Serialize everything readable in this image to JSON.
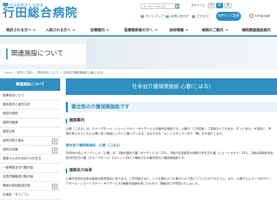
{
  "header": {
    "logo_sub": "社会医療法人 壮幸会",
    "logo_main": "行田総合病院",
    "search_placeholder": "キーワードを入力",
    "links": [
      "サイトマップ",
      "お問い合わせ",
      "アクセス"
    ],
    "text_size_label": "文字サイズ",
    "size_buttons": [
      "小",
      "中",
      "大"
    ],
    "font_button": "文字サイズ変更",
    "language": "Language"
  },
  "nav": {
    "items": [
      "受診される方へ",
      "入院される方へ",
      "診療案内",
      "医療関係者の方へ",
      "採用情報",
      "病院のご案内",
      "病院関連施設案内"
    ]
  },
  "banner": {
    "title": "関連施設について"
  },
  "breadcrumb": {
    "items": [
      "Home",
      "病院のご案内",
      "関連施設について"
    ],
    "current": "壮幸会介護保険施設 心春(こはる)"
  },
  "sidebar": {
    "heading": "関連施設について",
    "items": [
      "理事長あいさつ",
      "基本理念と運営方針",
      "病院の特色",
      "病院の概要",
      "病院沿革",
      "病院の取り組み",
      "病院の実績",
      "患者さんのための7つの宣言",
      "一般事業主の行動計画",
      "女性活躍推進行動計画",
      "職員の負担軽減対策",
      "広報誌「そうこう」"
    ]
  },
  "main": {
    "title": "壮幸会介護保険施設 心春(こはる)",
    "h2": "複合型の介護保険施設です",
    "section1_title": "施設案内",
    "section1_text": "心春（こはる）は、グループホーム・ショートステイ・デイサービスの複合型施設です。心春は「ご利用者・ご家族がいつも安心・ずっと安心」を理念に、地域の皆さまとともに心通い合う施設にしたいと願っています。みなさまの「心」にスタッフ一同で「春」をお届けします。",
    "sub_title": "複合型介護保険施設　心春（こはる）",
    "sub_text": "2009年4月にオープンした「心春」は、3階の通所介護（デイサービス）25人、2階が全室個室の短期入所生活介護（ショートステイ）20人、3階は認知症対応型共同生活介護（グループホーム）2ユニット18人で構成される複合型の介護保険施設です。",
    "section2_title": "施設名の由来",
    "section2_text": "心春の名前の由来は施設の基本理念にあります。ご利用者さまに、いつも春のように暖かい心で過ごしていただけるように。また、心春ちゃんマークはグループホーム・ショートステイ・デイサービス3事業の協調を表したもので、職員自らが考案いたしました。"
  }
}
